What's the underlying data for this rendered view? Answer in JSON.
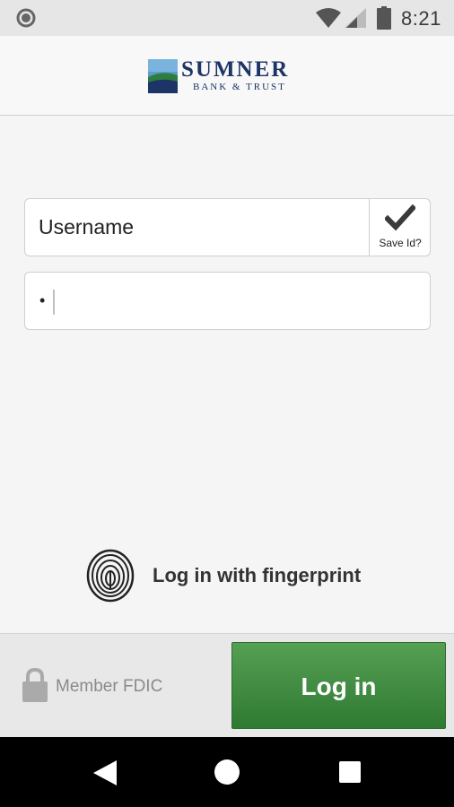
{
  "status_bar": {
    "time": "8:21"
  },
  "logo": {
    "name": "SUMNER",
    "subtitle": "BANK & TRUST"
  },
  "form": {
    "username_placeholder": "Username",
    "save_id_label": "Save Id?",
    "save_id_checked": true,
    "password_mask": "•"
  },
  "fingerprint": {
    "label": "Log in with fingerprint"
  },
  "footer": {
    "fdic_label": "Member FDIC",
    "login_label": "Log in"
  },
  "colors": {
    "brand_navy": "#1c3566",
    "login_green": "#3f8c40",
    "logo_blue": "#4f8fc6"
  }
}
